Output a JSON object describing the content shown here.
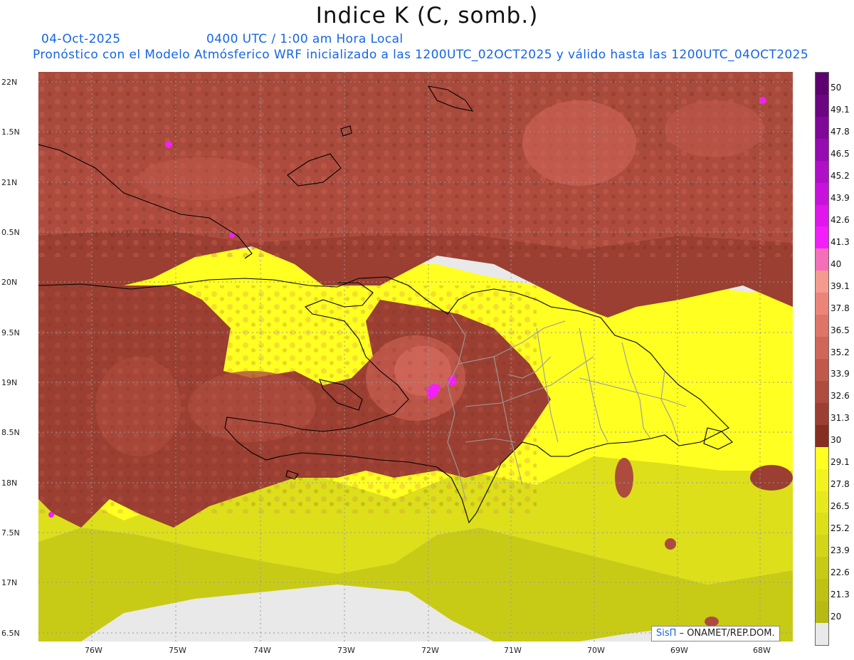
{
  "title": "Indice K (C, somb.)",
  "header": {
    "date": "04-Oct-2025",
    "time": "0400 UTC / 1:00 am Hora Local",
    "description": "Pronóstico con el Modelo Atmósferico WRF inicializado a las 1200UTC_02OCT2025 y válido hasta las  1200UTC_04OCT2025"
  },
  "axes": {
    "y_labels": [
      "22N",
      "1.5N",
      "21N",
      "0.5N",
      "20N",
      "9.5N",
      "19N",
      "8.5N",
      "18N",
      "7.5N",
      "17N",
      "6.5N"
    ],
    "x_labels": [
      "76W",
      "75W",
      "74W",
      "73W",
      "72W",
      "71W",
      "70W",
      "69W",
      "68W"
    ],
    "lat_range": [
      16.5,
      22.1
    ],
    "lon_range": [
      -76.6,
      -67.6
    ]
  },
  "credit": {
    "brand": "SisΠ",
    "text": "– ONAMET/REP.DOM."
  },
  "colorbar": {
    "labels": [
      "50",
      "49.1",
      "47.8",
      "46.5",
      "45.2",
      "43.9",
      "42.6",
      "41.3",
      "40",
      "39.1",
      "37.8",
      "36.5",
      "35.2",
      "33.9",
      "32.6",
      "31.3",
      "30",
      "29.1",
      "27.8",
      "26.5",
      "25.2",
      "23.9",
      "22.6",
      "21.3",
      "20"
    ],
    "colors": [
      "#5e0070",
      "#6c0582",
      "#7f0898",
      "#960bb0",
      "#b00fc8",
      "#c812dc",
      "#e016ec",
      "#f41ef8",
      "#f56eb8",
      "#f49a8f",
      "#ec8479",
      "#df7468",
      "#d06659",
      "#c0594c",
      "#ad4c3e",
      "#9a3f31",
      "#862f20",
      "#ffff22",
      "#f2f21e",
      "#e7e91c",
      "#dcdf1a",
      "#d2d518",
      "#c8cb16",
      "#bfc214",
      "#b7ba12",
      "#e9e9e9"
    ]
  }
}
